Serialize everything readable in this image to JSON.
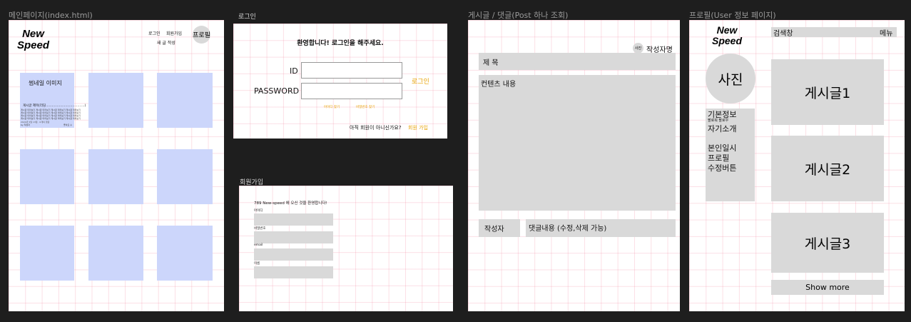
{
  "frames": {
    "main": "메인페이지(index.html)",
    "login": "로그인",
    "signup": "회원가입",
    "post": "게시글 / 댓글(Post 하나 조회)",
    "profile": "프로필(User 정보 페이지)"
  },
  "main": {
    "logo_line1": "New",
    "logo_line2": "Speed",
    "nav_login": "로그인",
    "nav_signup": "회원가입",
    "nav_write": "새 글 작성",
    "nav_profile": "프로필",
    "card": {
      "thumbnail": "썸네일 이미지",
      "title": "게시글 제목(리딩......................................)",
      "body_lines": [
        "게시글 미리보기 게시글 미리보기 게시글 미리보기 게시글 미리보기",
        "게시글 미리보기 게시글 미리보기 게시글 미리보기 게시글 미리보기",
        "게시글 미리보기 게시글 미리보기 게시글 미리보기 게시글 미리보기",
        "게시글 미리보기 게시글 미리보기 게시글 미리보기 게시글 미리보기"
      ],
      "date": "2022년 5월 13일 · 0개의 댓글",
      "author": "by 작성자",
      "likes": "좋아요 수"
    }
  },
  "login": {
    "welcome": "환영합니다! 로그인을 해주세요.",
    "id_label": "ID",
    "pw_label": "PASSWORD",
    "login_button": "로그인",
    "find_id": "아이디 찾기",
    "find_pw": "비밀번호 찾기",
    "not_member": "아직 회원이 아니신가요?",
    "join": "회원 가입"
  },
  "signup": {
    "welcome": "789 New-speed 에 오신 것을 환영합니다!",
    "fields": [
      "아이디",
      "비밀번호",
      "email",
      "이름"
    ]
  },
  "post": {
    "photo": "사진",
    "author_name": "작성자명",
    "title": "제 목",
    "content": "컨텐츠 내용",
    "comment_author": "작성자",
    "comment_content": "댓글내용 (수정,삭제 가능)"
  },
  "profile": {
    "logo_line1": "New",
    "logo_line2": "Speed",
    "search": "검색창",
    "menu": "메뉴",
    "photo": "사진",
    "basic_info": "기본정보",
    "followers": "팔로워 팔로우",
    "intro": "자기소개",
    "edit_line1": "본인일시",
    "edit_line2": "프로필",
    "edit_line3": "수정버튼",
    "posts": [
      "게시글1",
      "게시글2",
      "게시글3"
    ],
    "show_more": "Show more"
  },
  "colors": {
    "canvas": "#1e1e1e",
    "placeholder_gray": "#d9d9d9",
    "card_blue": "#ccd6fb",
    "accent_orange": "#e7a100",
    "grid_pink": "#f06e8c"
  }
}
